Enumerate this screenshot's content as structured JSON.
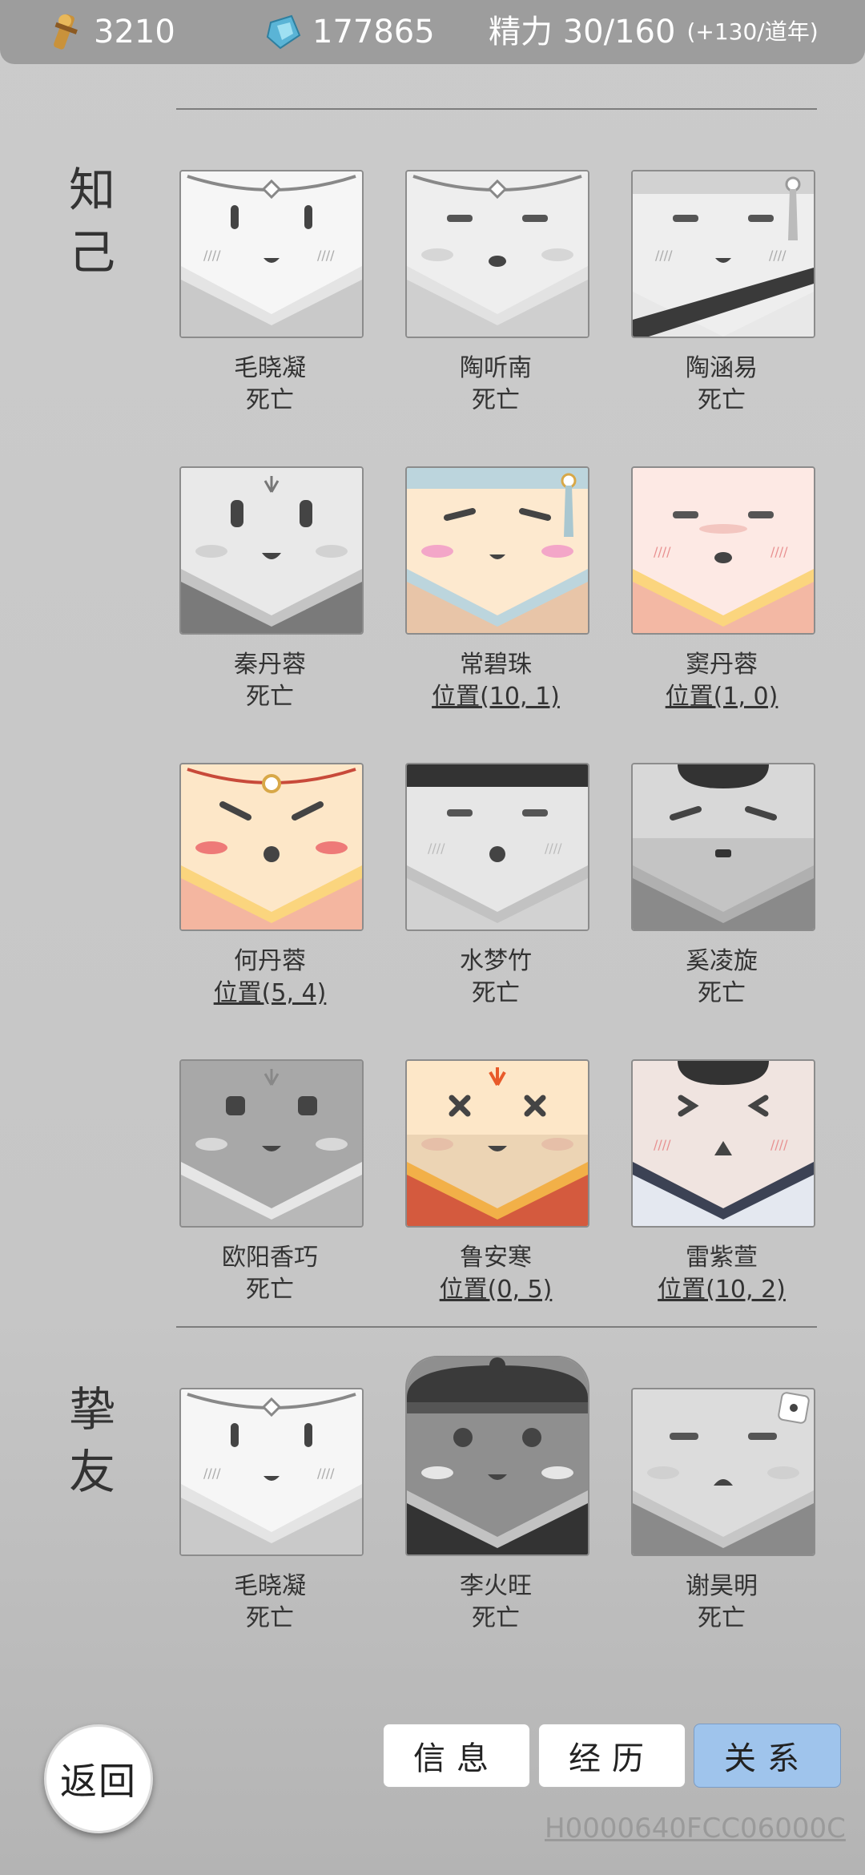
{
  "topbar": {
    "coins": "3210",
    "gems": "177865",
    "energy": "精力 30/160",
    "energy_note": "(+130/道年)"
  },
  "sections": {
    "acquaintances_title": "知己",
    "friends_title": "挚友"
  },
  "acquaintances": [
    {
      "name": "毛晓凝",
      "status": "死亡"
    },
    {
      "name": "陶听南",
      "status": "死亡"
    },
    {
      "name": "陶涵易",
      "status": "死亡"
    },
    {
      "name": "秦丹蓉",
      "status": "死亡"
    },
    {
      "name": "常碧珠",
      "status": "位置(10, 1)"
    },
    {
      "name": "窦丹蓉",
      "status": "位置(1, 0)"
    },
    {
      "name": "何丹蓉",
      "status": "位置(5, 4)"
    },
    {
      "name": "水梦竹",
      "status": "死亡"
    },
    {
      "name": "奚凌旋",
      "status": "死亡"
    },
    {
      "name": "欧阳香巧",
      "status": "死亡"
    },
    {
      "name": "鲁安寒",
      "status": "位置(0, 5)"
    },
    {
      "name": "雷紫萱",
      "status": "位置(10, 2)"
    }
  ],
  "friends": [
    {
      "name": "毛晓凝",
      "status": "死亡"
    },
    {
      "name": "李火旺",
      "status": "死亡"
    },
    {
      "name": "谢昊明",
      "status": "死亡"
    }
  ],
  "buttons": {
    "back": "返回",
    "info": "信息",
    "history": "经历",
    "relations": "关系"
  },
  "footer_code": "H0000640FCC06000C",
  "colors": {
    "tab_active": "#9fc4ec",
    "topbar": "#9d9d9d"
  }
}
